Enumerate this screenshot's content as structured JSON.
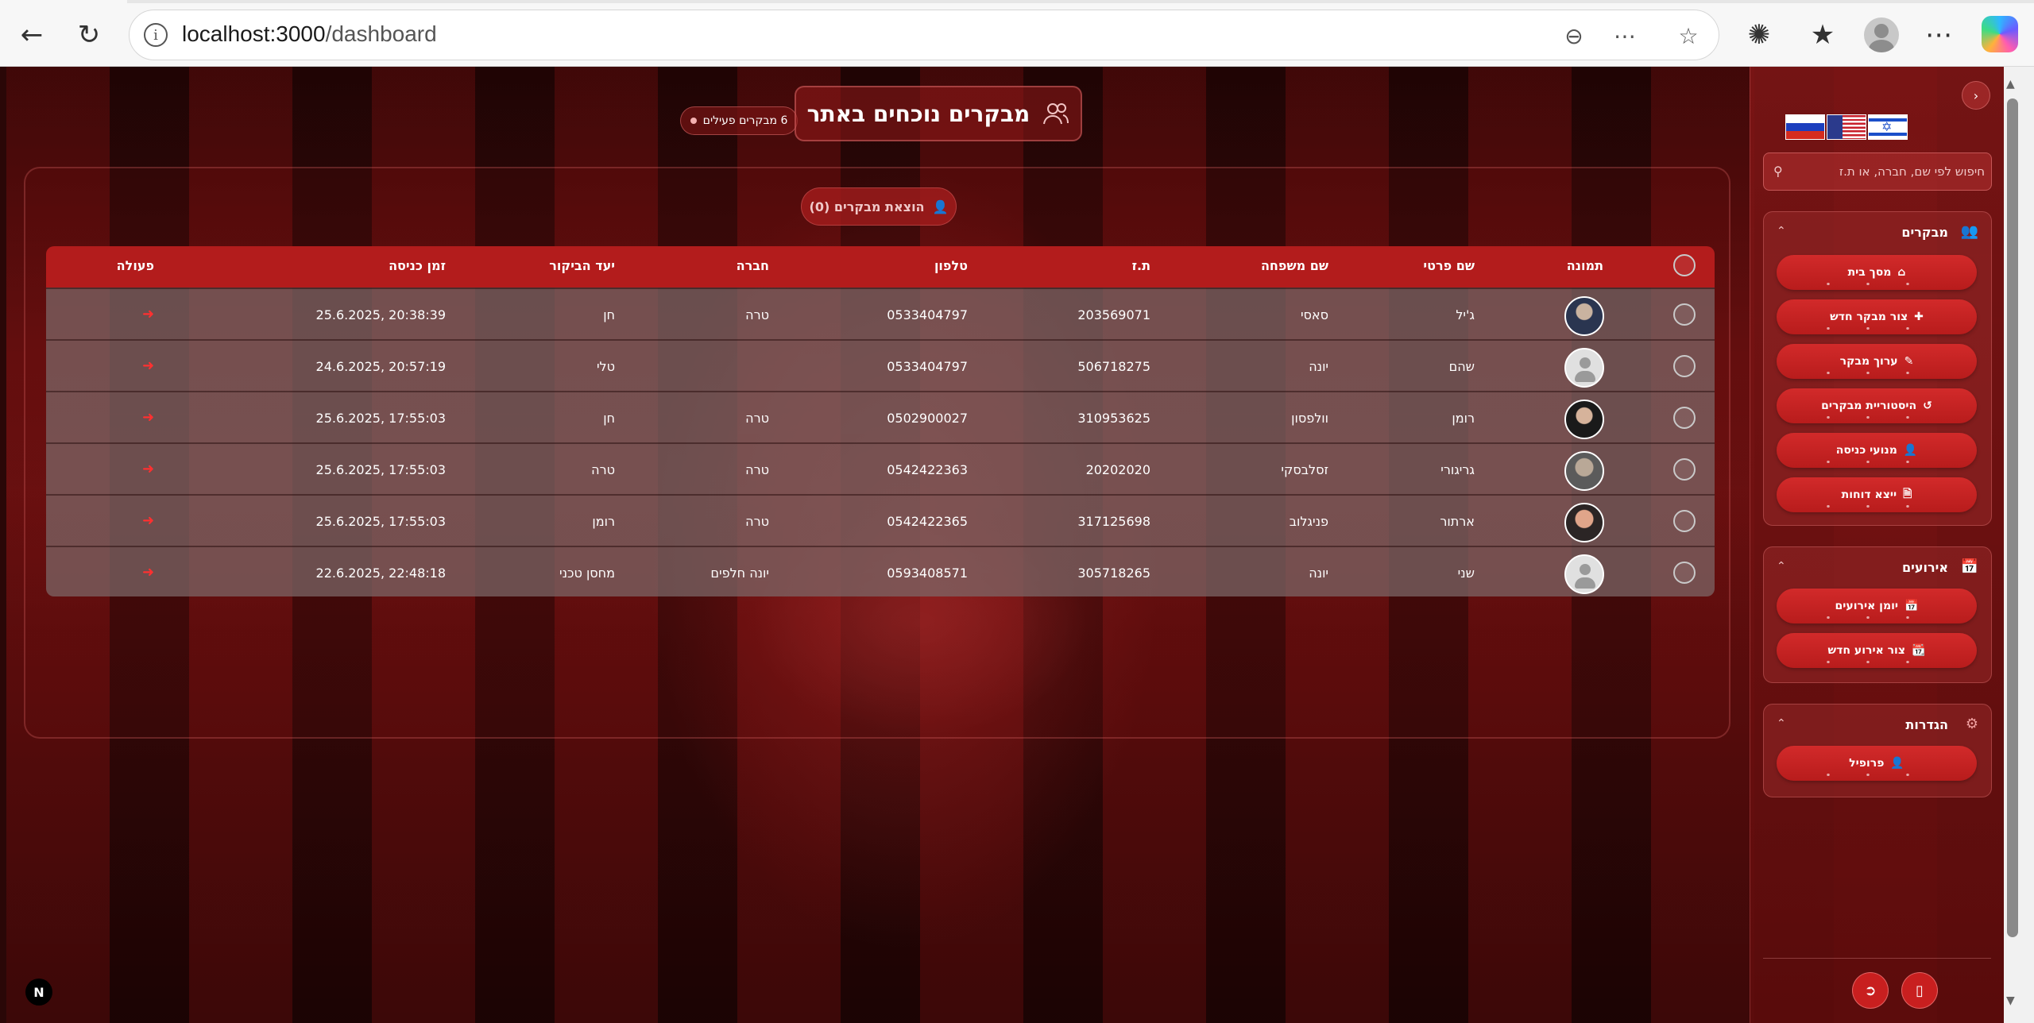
{
  "browser": {
    "url_host": "localhost:3000",
    "url_path": "/dashboard"
  },
  "header": {
    "title": "מבקרים נוכחים באתר",
    "active_badge": "6 מבקרים פעילים"
  },
  "toolbar": {
    "export_label": "הוצאת מבקרים (0)"
  },
  "table": {
    "columns": {
      "photo": "תמונה",
      "first_name": "שם פרטי",
      "last_name": "שם משפחה",
      "id": "ת.ז",
      "phone": "טלפון",
      "company": "חברה",
      "destination": "יעד הביקור",
      "entry_time": "זמן כניסה",
      "action": "פעולה"
    },
    "rows": [
      {
        "first_name": "ג'יל",
        "last_name": "סאסי",
        "id": "203569071",
        "phone": "0533404797",
        "company": "טרה",
        "destination": "חן",
        "entry_time": "25.6.2025, 20:38:39",
        "avatar": "photo1"
      },
      {
        "first_name": "שהם",
        "last_name": "יונה",
        "id": "506718275",
        "phone": "0533404797",
        "company": "",
        "destination": "טלי",
        "entry_time": "24.6.2025, 20:57:19",
        "avatar": "placeholder"
      },
      {
        "first_name": "רומן",
        "last_name": "וולפסון",
        "id": "310953625",
        "phone": "0502900027",
        "company": "טרה",
        "destination": "חן",
        "entry_time": "25.6.2025, 17:55:03",
        "avatar": "photo2"
      },
      {
        "first_name": "גריגורי",
        "last_name": "זסלבסקי",
        "id": "20202020",
        "phone": "0542422363",
        "company": "טרה",
        "destination": "טרה",
        "entry_time": "25.6.2025, 17:55:03",
        "avatar": "photo3"
      },
      {
        "first_name": "ארתור",
        "last_name": "פניגלוב",
        "id": "317125698",
        "phone": "0542422365",
        "company": "טרה",
        "destination": "רומן",
        "entry_time": "25.6.2025, 17:55:03",
        "avatar": "photo4"
      },
      {
        "first_name": "שני",
        "last_name": "יונה",
        "id": "305718265",
        "phone": "0593408571",
        "company": "יונה חלפים",
        "destination": "מחסן טכני",
        "entry_time": "22.6.2025, 22:48:18",
        "avatar": "placeholder"
      }
    ]
  },
  "sidebar": {
    "search_placeholder": "חיפוש לפי שם, חברה, או ת.ז",
    "sections": [
      {
        "title": "מבקרים",
        "icon": "users-icon",
        "items": [
          {
            "label": "מסך בית",
            "icon": "home-icon"
          },
          {
            "label": "צור מבקר חדש",
            "icon": "user-plus-icon"
          },
          {
            "label": "ערוך מבקר",
            "icon": "user-edit-icon"
          },
          {
            "label": "היסטוריית מבקרים",
            "icon": "history-icon"
          },
          {
            "label": "מנועי כניסה",
            "icon": "user-lock-icon"
          },
          {
            "label": "ייצא דוחות",
            "icon": "file-export-icon"
          }
        ]
      },
      {
        "title": "אירועים",
        "icon": "calendar-icon",
        "items": [
          {
            "label": "יומן אירועים",
            "icon": "calendar-icon"
          },
          {
            "label": "צור אירוע חדש",
            "icon": "calendar-plus-icon"
          }
        ]
      },
      {
        "title": "הגדרות",
        "icon": "gear-icon",
        "items": [
          {
            "label": "פרופיל",
            "icon": "user-icon"
          }
        ]
      }
    ]
  },
  "next_badge": "N",
  "colors": {
    "accent": "#b31c1c",
    "button": "#d22a2a",
    "exit_icon": "#ff3030"
  }
}
